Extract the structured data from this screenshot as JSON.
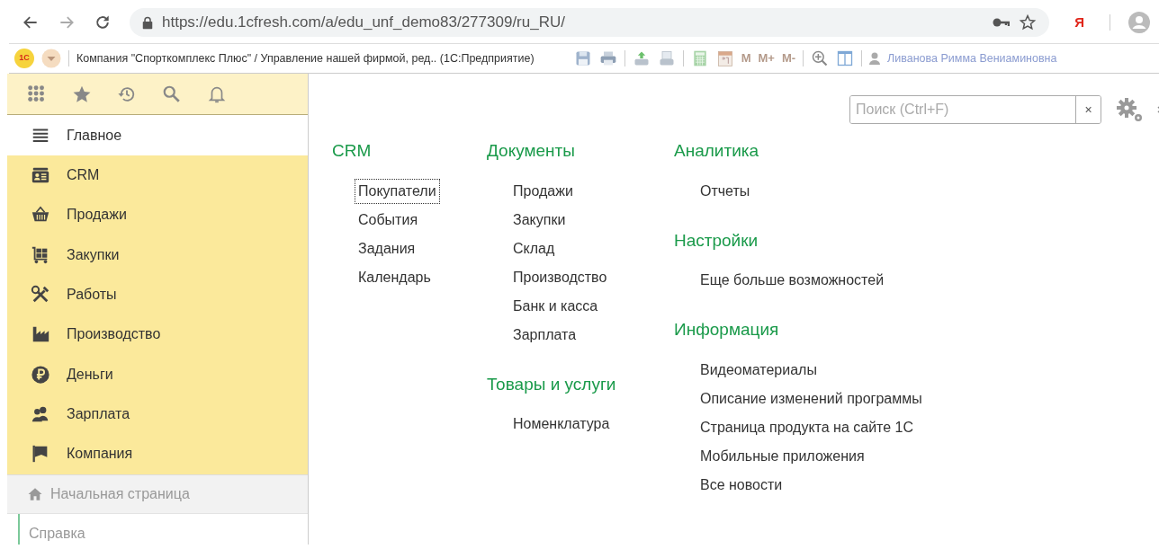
{
  "browser": {
    "url": "https://edu.1cfresh.com/a/edu_unf_demo83/277309/ru_RU/",
    "profile_letter": "Я"
  },
  "app_bar": {
    "logo": "1С",
    "title": "Компания \"Спорткомплекс Плюс\" / Управление нашей фирмой, ред.. (1С:Предприятие)",
    "memory_buttons": [
      "M",
      "M+",
      "M-"
    ],
    "user": "Ливанова Римма Вениаминовна"
  },
  "sidebar": {
    "items": [
      {
        "label": "Главное",
        "selected": true
      },
      {
        "label": "CRM",
        "selected": false
      },
      {
        "label": "Продажи",
        "selected": false
      },
      {
        "label": "Закупки",
        "selected": false
      },
      {
        "label": "Работы",
        "selected": false
      },
      {
        "label": "Производство",
        "selected": false
      },
      {
        "label": "Деньги",
        "selected": false
      },
      {
        "label": "Зарплата",
        "selected": false
      },
      {
        "label": "Компания",
        "selected": false
      }
    ],
    "home": "Начальная страница",
    "help": "Справка"
  },
  "search": {
    "placeholder": "Поиск (Ctrl+F)",
    "clear": "×"
  },
  "columns": [
    [
      {
        "title": "CRM",
        "links": [
          {
            "label": "Покупатели",
            "focused": true
          },
          {
            "label": "События",
            "focused": false
          },
          {
            "label": "Задания",
            "focused": false
          },
          {
            "label": "Календарь",
            "focused": false
          }
        ]
      }
    ],
    [
      {
        "title": "Документы",
        "links": [
          {
            "label": "Продажи",
            "focused": false
          },
          {
            "label": "Закупки",
            "focused": false
          },
          {
            "label": "Склад",
            "focused": false
          },
          {
            "label": "Производство",
            "focused": false
          },
          {
            "label": "Банк и касса",
            "focused": false
          },
          {
            "label": "Зарплата",
            "focused": false
          }
        ]
      },
      {
        "title": "Товары и услуги",
        "links": [
          {
            "label": "Номенклатура",
            "focused": false
          }
        ]
      }
    ],
    [
      {
        "title": "Аналитика",
        "links": [
          {
            "label": "Отчеты",
            "focused": false
          }
        ]
      },
      {
        "title": "Настройки",
        "links": [
          {
            "label": "Еще больше возможностей",
            "focused": false
          }
        ]
      },
      {
        "title": "Информация",
        "links": [
          {
            "label": "Видеоматериалы",
            "focused": false
          },
          {
            "label": "Описание изменений программы",
            "focused": false
          },
          {
            "label": "Страница продукта на сайте 1С",
            "focused": false
          },
          {
            "label": "Мобильные приложения",
            "focused": false
          },
          {
            "label": "Все новости",
            "focused": false
          }
        ]
      }
    ]
  ]
}
